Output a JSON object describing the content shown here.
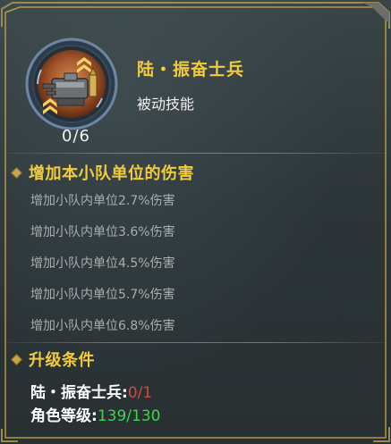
{
  "skill": {
    "name": "陆・振奋士兵",
    "type": "被动技能",
    "level": "0/6",
    "icon": "cannon-turret-icon"
  },
  "effects": {
    "heading": "增加本小队单位的伤害",
    "items": [
      "增加小队内单位2.7%伤害",
      "增加小队内单位3.6%伤害",
      "增加小队内单位4.5%伤害",
      "增加小队内单位5.7%伤害",
      "增加小队内单位6.8%伤害"
    ]
  },
  "requirements": {
    "heading": "升级条件",
    "items": [
      {
        "label": "陆・振奋士兵:",
        "current": "0",
        "sep": "/",
        "total": "1"
      },
      {
        "label": "角色等级:",
        "current": "139",
        "sep": "/",
        "total": "130"
      }
    ]
  },
  "colors": {
    "title_gold": "#f3cc3c",
    "current_red": "#d8484a",
    "current_green": "#3fd34f",
    "frame_gold": "#c9a94a"
  }
}
